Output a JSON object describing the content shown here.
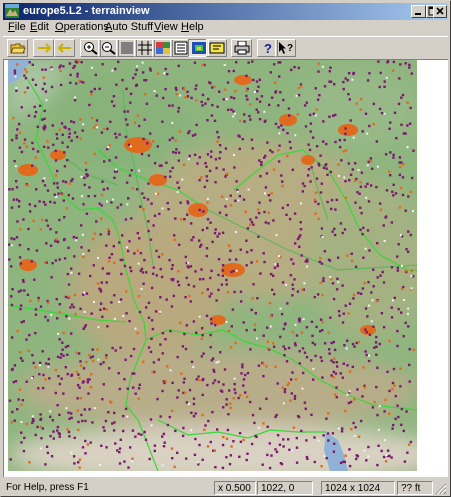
{
  "window": {
    "title": "europe5.L2 - terrainview",
    "controls": {
      "minimize": "_",
      "maximize": "□",
      "close": "×"
    }
  },
  "menu": [
    {
      "mnemonic": "F",
      "rest": "ile"
    },
    {
      "mnemonic": "E",
      "rest": "dit"
    },
    {
      "mnemonic": "O",
      "rest": "perations"
    },
    {
      "mnemonic": "A",
      "rest": "uto Stuff"
    },
    {
      "mnemonic": "V",
      "rest": "iew"
    },
    {
      "mnemonic": "H",
      "rest": "elp"
    }
  ],
  "toolbar": [
    "open-folder-icon",
    "arrow-right-icon",
    "arrow-left-icon",
    "zoom-in-icon",
    "zoom-out-icon",
    "fill-square-icon",
    "grid-icon",
    "terrain-icon",
    "list-icon",
    "elevation-icon",
    "label-icon",
    "print-icon",
    "help-icon",
    "context-help-icon"
  ],
  "map": {
    "colors": {
      "lowland": "#8fb57f",
      "highland": "#bcae86",
      "mountain": "#d9d2c2",
      "water": "#8fb2d6",
      "border": "#39d63a",
      "river": "#5db85d",
      "city": "#e06a1e",
      "village": "#7a1a6e",
      "hamlet": "#f3f3f3"
    }
  },
  "status": {
    "help": "For Help, press F1",
    "zoom": "x 0.500",
    "coords": "1022, 0",
    "size": "1024 x 1024",
    "elevation": "?? ft"
  }
}
